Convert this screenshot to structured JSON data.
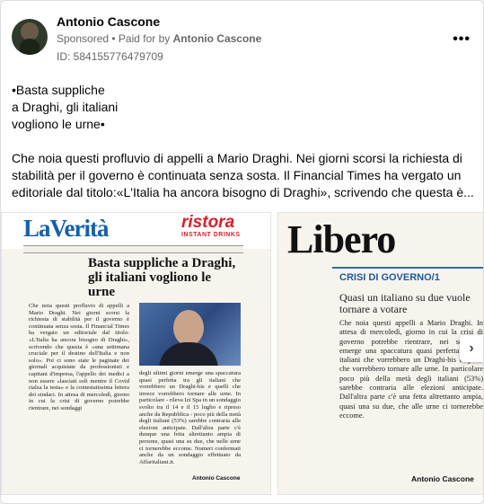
{
  "post": {
    "author": "Antonio Cascone",
    "sponsored": "Sponsored",
    "paid_for_prefix": "• Paid for by",
    "paid_for_name": "Antonio Cascone",
    "id_label": "ID: 584155776479709",
    "more_label": "•••",
    "intro": "•Basta suppliche\na Draghi, gli italiani\nvogliono le urne•",
    "body": "Che noia questi profluvio di appelli a Mario Draghi. Nei giorni scorsi la richiesta di stabilità per il governo è continuata senza sosta. Il Financial Times ha vergato un editoriale dal titolo:«L'Italia ha ancora bisogno di Draghi», scrivendo che questa è..."
  },
  "slide1": {
    "logo": "LaVerità",
    "brand_top": "ristora",
    "brand_sub": "INSTANT DRINKS",
    "headline": "Basta suppliche a Draghi, gli italiani vogliono le urne",
    "col1": "Che noia questi profluvio di appelli a Mario Draghi. Nei giorni scorsi la richiesta di stabilità per il governo è continuata senza sosta. Il Financial Times ha vergato un editoriale dal titolo: «L'Italia ha ancora bisogno di Draghi», scrivendo che questa è «una settimana cruciale per il destino dell'Italia e non solo». Poi ci sono state le paginate dei giornali acquistate da professionisti e capitani d'impresa, l'appello dei medici a non essere «lasciati soli mentre il Covid rialza la testa» e la contestatissima lettera dei sindaci. In attesa di mercoledì, giorno in cui la crisi di governo potrebbe rientrare, nei sondaggi",
    "col2": "degli ultimi giorni emerge una spaccatura quasi perfetta tra gli italiani che vorrebbero un Draghi-bis e quelli che invece vorrebbero tornare alle urne. In particolare - rileva Izi Spa in un sondaggio svolto tra il 14 e il 15 luglio e ripreso anche da Repubblica - poco più della metà degli italiani (53%) sarebbe contraria alle elezioni anticipate. Dall'altra parte c'è dunque una fetta altrettanto ampia di persone, quasi una su due, che nelle urne ci tornerebbe eccome. Numeri confermati anche da un sondaggio effettuato da Affaritaliani.it.",
    "signature": "Antonio Cascone"
  },
  "slide2": {
    "logo": "Libero",
    "kicker": "CRISI DI GOVERNO/1",
    "subhead": "Quasi un italiano su due vuole tornare a votare",
    "text": "Che noia questi appelli a Mario Draghi. In attesa di mercoledì, giorno in cui la crisi di governo potrebbe rientrare, nei sondaggi emerge una spaccatura quasi perfetta tra gli italiani che vorrebbero un Draghi-bis e quelli che vorrebbero tornare alle urne. In particolare poco più della metà degli italiani (53%) sarebbe contraria alle elezioni anticipate. Dall'altra parte c'è una fetta altrettanto ampia, quasi una su due, che alle urne ci tornerebbe eccome.",
    "signature": "Antonio Cascone"
  },
  "carousel": {
    "next_icon": "›"
  }
}
